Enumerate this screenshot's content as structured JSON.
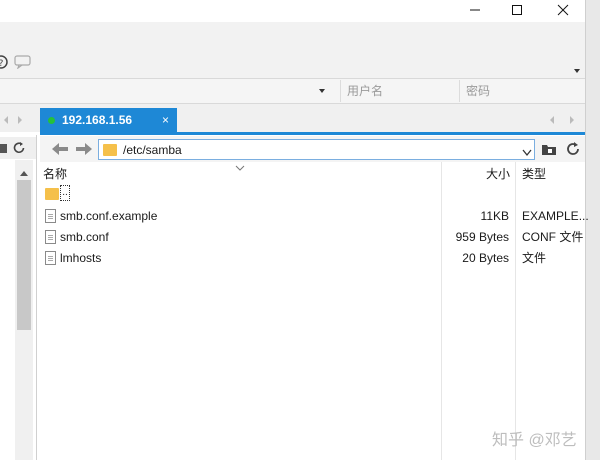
{
  "tab": {
    "label": "192.168.1.56",
    "close": "×"
  },
  "connection": {
    "user_placeholder": "用户名",
    "pass_placeholder": "密码"
  },
  "path": {
    "value": "/etc/samba"
  },
  "columns": {
    "name": "名称",
    "size": "大小",
    "type": "类型"
  },
  "parent_dir": {
    "label": ".."
  },
  "files": [
    {
      "name": "smb.conf.example",
      "size": "11KB",
      "type": "EXAMPLE..."
    },
    {
      "name": "smb.conf",
      "size": "959 Bytes",
      "type": "CONF 文件"
    },
    {
      "name": "lmhosts",
      "size": "20 Bytes",
      "type": "文件"
    }
  ],
  "watermark": "知乎 @邓艺"
}
